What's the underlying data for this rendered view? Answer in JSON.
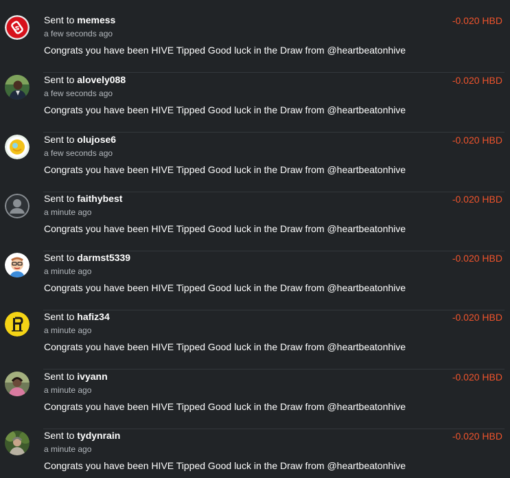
{
  "colors": {
    "background": "#212427",
    "amount_negative": "#f0542c",
    "text_primary": "#ffffff",
    "text_secondary": "#b4b9be"
  },
  "transfers": [
    {
      "prefix": "Sent to",
      "user": "memess",
      "time": "a few seconds ago",
      "memo": "Congrats you have been HIVE Tipped Good luck in the Draw from @heartbeatonhive",
      "amount": "-0.020 HBD",
      "avatar": "red-logo-avatar"
    },
    {
      "prefix": "Sent to",
      "user": "alovely088",
      "time": "a few seconds ago",
      "memo": "Congrats you have been HIVE Tipped Good luck in the Draw from @heartbeatonhive",
      "amount": "-0.020 HBD",
      "avatar": "photo-avatar"
    },
    {
      "prefix": "Sent to",
      "user": "olujose6",
      "time": "a few seconds ago",
      "memo": "Congrats you have been HIVE Tipped Good luck in the Draw from @heartbeatonhive",
      "amount": "-0.020 HBD",
      "avatar": "yellow-circle-avatar"
    },
    {
      "prefix": "Sent to",
      "user": "faithybest",
      "time": "a minute ago",
      "memo": "Congrats you have been HIVE Tipped Good luck in the Draw from @heartbeatonhive",
      "amount": "-0.020 HBD",
      "avatar": "default-user-avatar"
    },
    {
      "prefix": "Sent to",
      "user": "darmst5339",
      "time": "a minute ago",
      "memo": "Congrats you have been HIVE Tipped Good luck in the Draw from @heartbeatonhive",
      "amount": "-0.020 HBD",
      "avatar": "cartoon-face-avatar"
    },
    {
      "prefix": "Sent to",
      "user": "hafiz34",
      "time": "a minute ago",
      "memo": "Congrats you have been HIVE Tipped Good luck in the Draw from @heartbeatonhive",
      "amount": "-0.020 HBD",
      "avatar": "yellow-logo-avatar"
    },
    {
      "prefix": "Sent to",
      "user": "ivyann",
      "time": "a minute ago",
      "memo": "Congrats you have been HIVE Tipped Good luck in the Draw from @heartbeatonhive",
      "amount": "-0.020 HBD",
      "avatar": "photo-avatar"
    },
    {
      "prefix": "Sent to",
      "user": "tydynrain",
      "time": "a minute ago",
      "memo": "Congrats you have been HIVE Tipped Good luck in the Draw from @heartbeatonhive",
      "amount": "-0.020 HBD",
      "avatar": "photo-avatar"
    }
  ]
}
